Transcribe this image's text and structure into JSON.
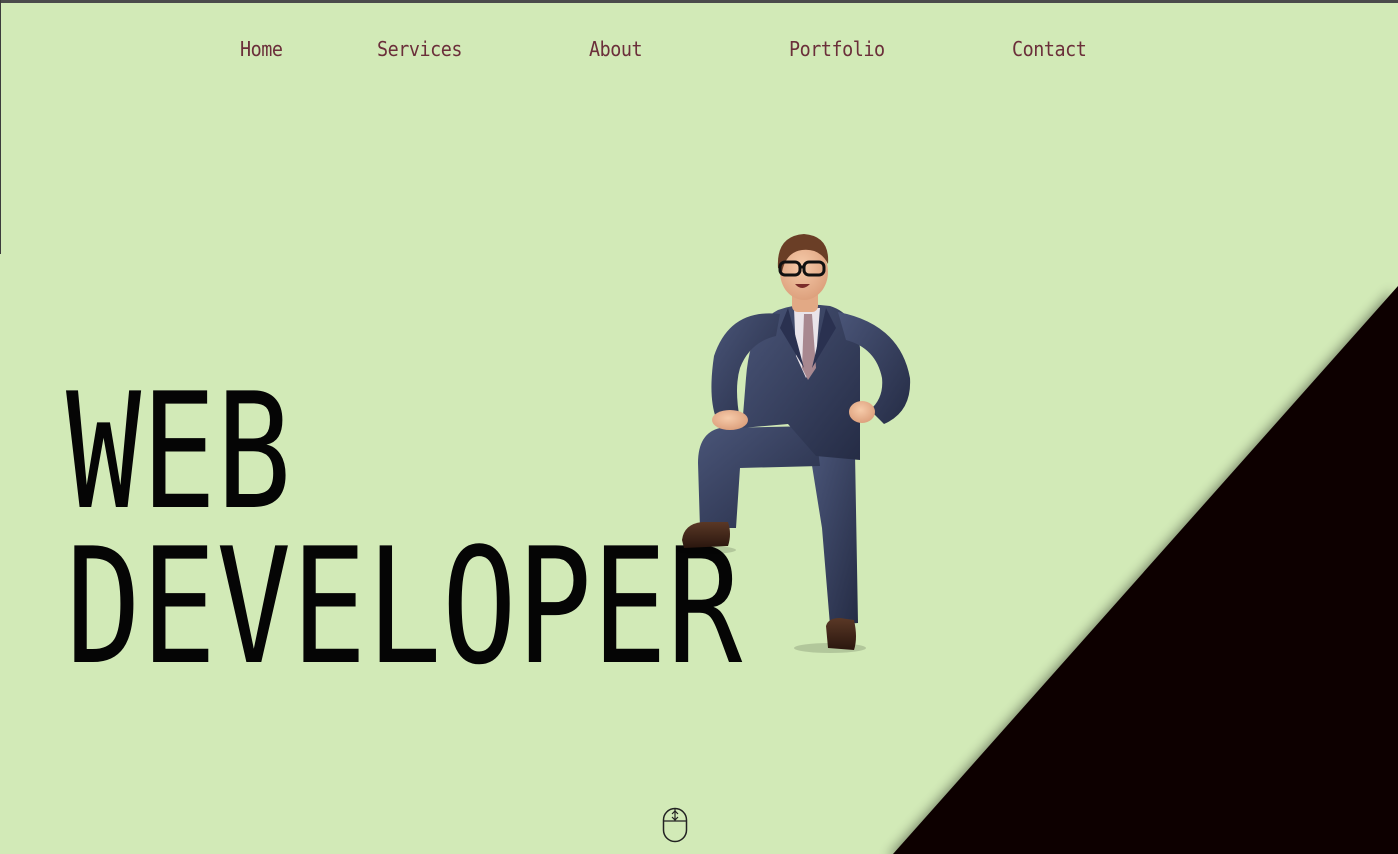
{
  "colors": {
    "background": "#d2eab7",
    "nav_text": "#6b2f3a",
    "hero_text": "#050505",
    "wedge": "#0d0404"
  },
  "nav": {
    "items": [
      {
        "label": "Home"
      },
      {
        "label": "Services"
      },
      {
        "label": "About"
      },
      {
        "label": "Portfolio"
      },
      {
        "label": "Contact"
      }
    ]
  },
  "hero": {
    "line1": "WEB",
    "line2": "DEVELOPER"
  },
  "illustration": {
    "icon": "businessman-character-illustration"
  },
  "scroll": {
    "icon": "mouse-scroll-icon"
  }
}
